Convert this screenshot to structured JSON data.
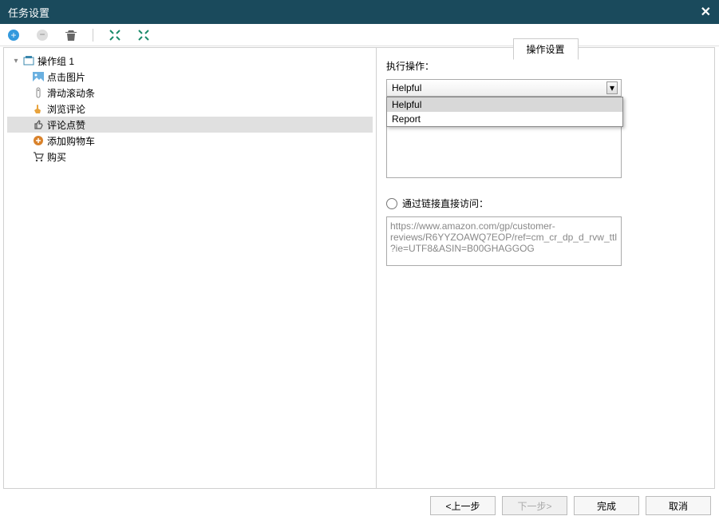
{
  "window": {
    "title": "任务设置"
  },
  "toolbar": {
    "add": "+",
    "remove": "−"
  },
  "tree": {
    "root": {
      "label": "操作组 1"
    },
    "items": [
      {
        "label": "点击图片",
        "icon": "image"
      },
      {
        "label": "滑动滚动条",
        "icon": "scroll"
      },
      {
        "label": "浏览评论",
        "icon": "hand"
      },
      {
        "label": "评论点赞",
        "icon": "thumb",
        "selected": true
      },
      {
        "label": "添加购物车",
        "icon": "cart-add"
      },
      {
        "label": "购买",
        "icon": "cart"
      }
    ]
  },
  "right": {
    "tab": "操作设置",
    "exec_label": "执行操作：",
    "select_value": "Helpful",
    "options": [
      "Helpful",
      "Report"
    ],
    "textarea_top": "",
    "radio_label": "通过链接直接访问：",
    "textarea_bottom": "https://www.amazon.com/gp/customer-reviews/R6YYZOAWQ7EOP/ref=cm_cr_dp_d_rvw_ttl?ie=UTF8&ASIN=B00GHAGGOG"
  },
  "footer": {
    "prev": "<上一步",
    "next": "下一步>",
    "finish": "完成",
    "cancel": "取消"
  }
}
